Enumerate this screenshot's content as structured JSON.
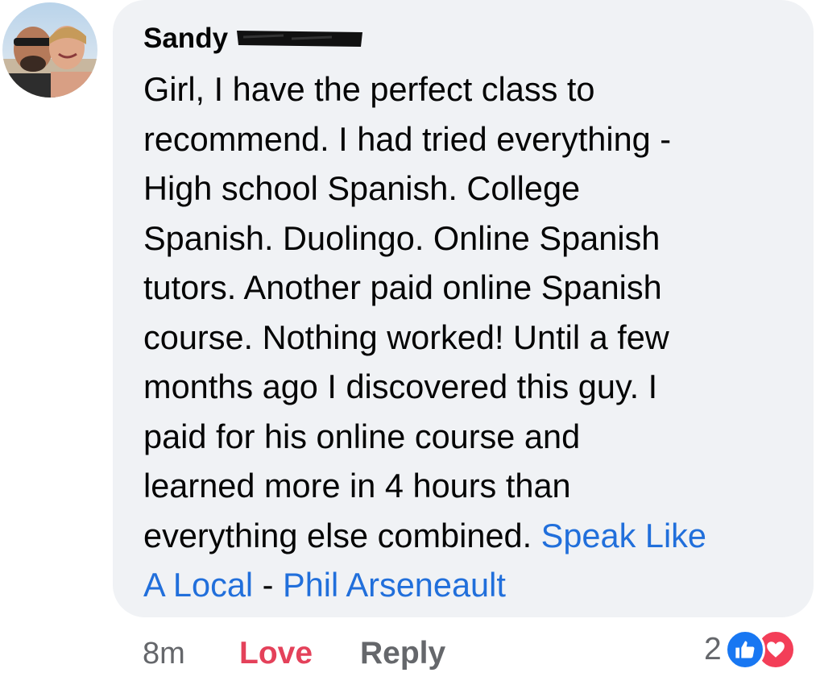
{
  "comment": {
    "author": "Sandy",
    "text": "Girl, I have the perfect class to\nrecommend. I had tried everything -\nHigh school Spanish. College\nSpanish. Duolingo. Online Spanish\ntutors. Another paid online Spanish\ncourse. Nothing worked!  Until a few\nmonths ago I discovered this guy. I\npaid for his online course and\nlearned more in 4 hours than\neverything else combined. ",
    "link_1": "Speak Like\nA Local",
    "link_separator": " - ",
    "link_2": "Phil Arseneault"
  },
  "actions": {
    "time": "8m",
    "love_label": "Love",
    "reply_label": "Reply"
  },
  "reactions": {
    "count": "2",
    "icons": [
      "like-icon",
      "heart-icon"
    ]
  },
  "colors": {
    "bubble": "#f0f2f5",
    "link": "#216fdb",
    "love": "#e4415a",
    "like": "#1877f2",
    "heart": "#f33e58"
  }
}
